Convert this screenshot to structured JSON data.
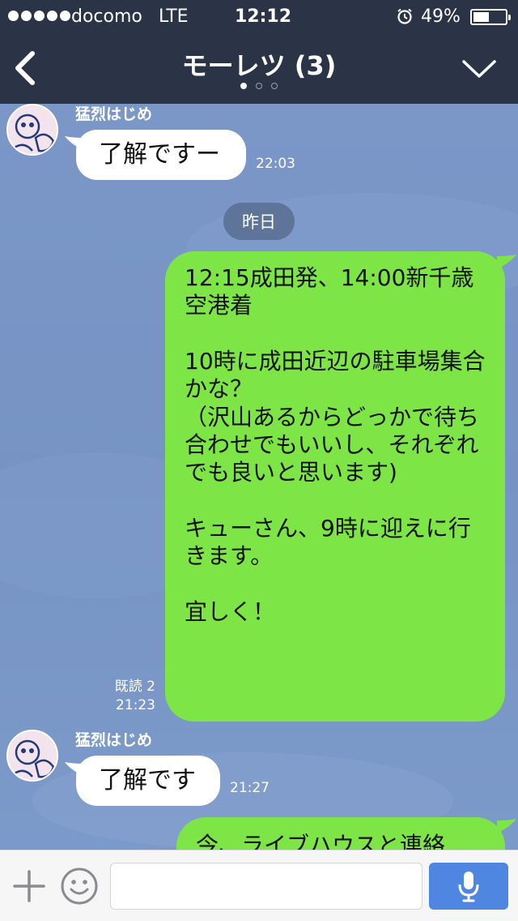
{
  "status_bar": {
    "carrier": "docomo",
    "network": "LTE",
    "time": "12:12",
    "battery": "49%",
    "battery_level": 0.49
  },
  "header": {
    "title": "モーレツ (3)",
    "page_dots": 3,
    "active_dot": 0
  },
  "chat": {
    "messages": [
      {
        "sender": "猛烈はじめ",
        "text": "了解ですー",
        "time": "22:03"
      },
      {
        "date_separator": "昨日"
      },
      {
        "outgoing": true,
        "paragraphs": [
          "12:15成田発、14:00新千歳空港着",
          "10時に成田近辺の駐車場集合かな？\n（沢山あるからどっかで待ち合わせでもいいし、それぞれでも良いと思います)",
          "キューさん、9時に迎えに行きます。",
          "宜しく！"
        ],
        "read_label": "既読 2",
        "time": "21:23"
      },
      {
        "sender": "猛烈はじめ",
        "text": "了解です",
        "time": "21:27"
      },
      {
        "outgoing": true,
        "text": "今、ライブハウスと連絡"
      }
    ]
  },
  "composer": {
    "placeholder": ""
  },
  "colors": {
    "header_bg": "#2b3347",
    "chat_bg": "#7693c4",
    "outgoing_bubble": "#7ee547",
    "incoming_bubble": "#ffffff",
    "mic_button": "#4f86e2"
  },
  "icons": [
    "back-chevron-icon",
    "dropdown-chevron-icon",
    "alarm-icon",
    "battery-icon",
    "plus-icon",
    "smiley-icon",
    "microphone-icon"
  ]
}
